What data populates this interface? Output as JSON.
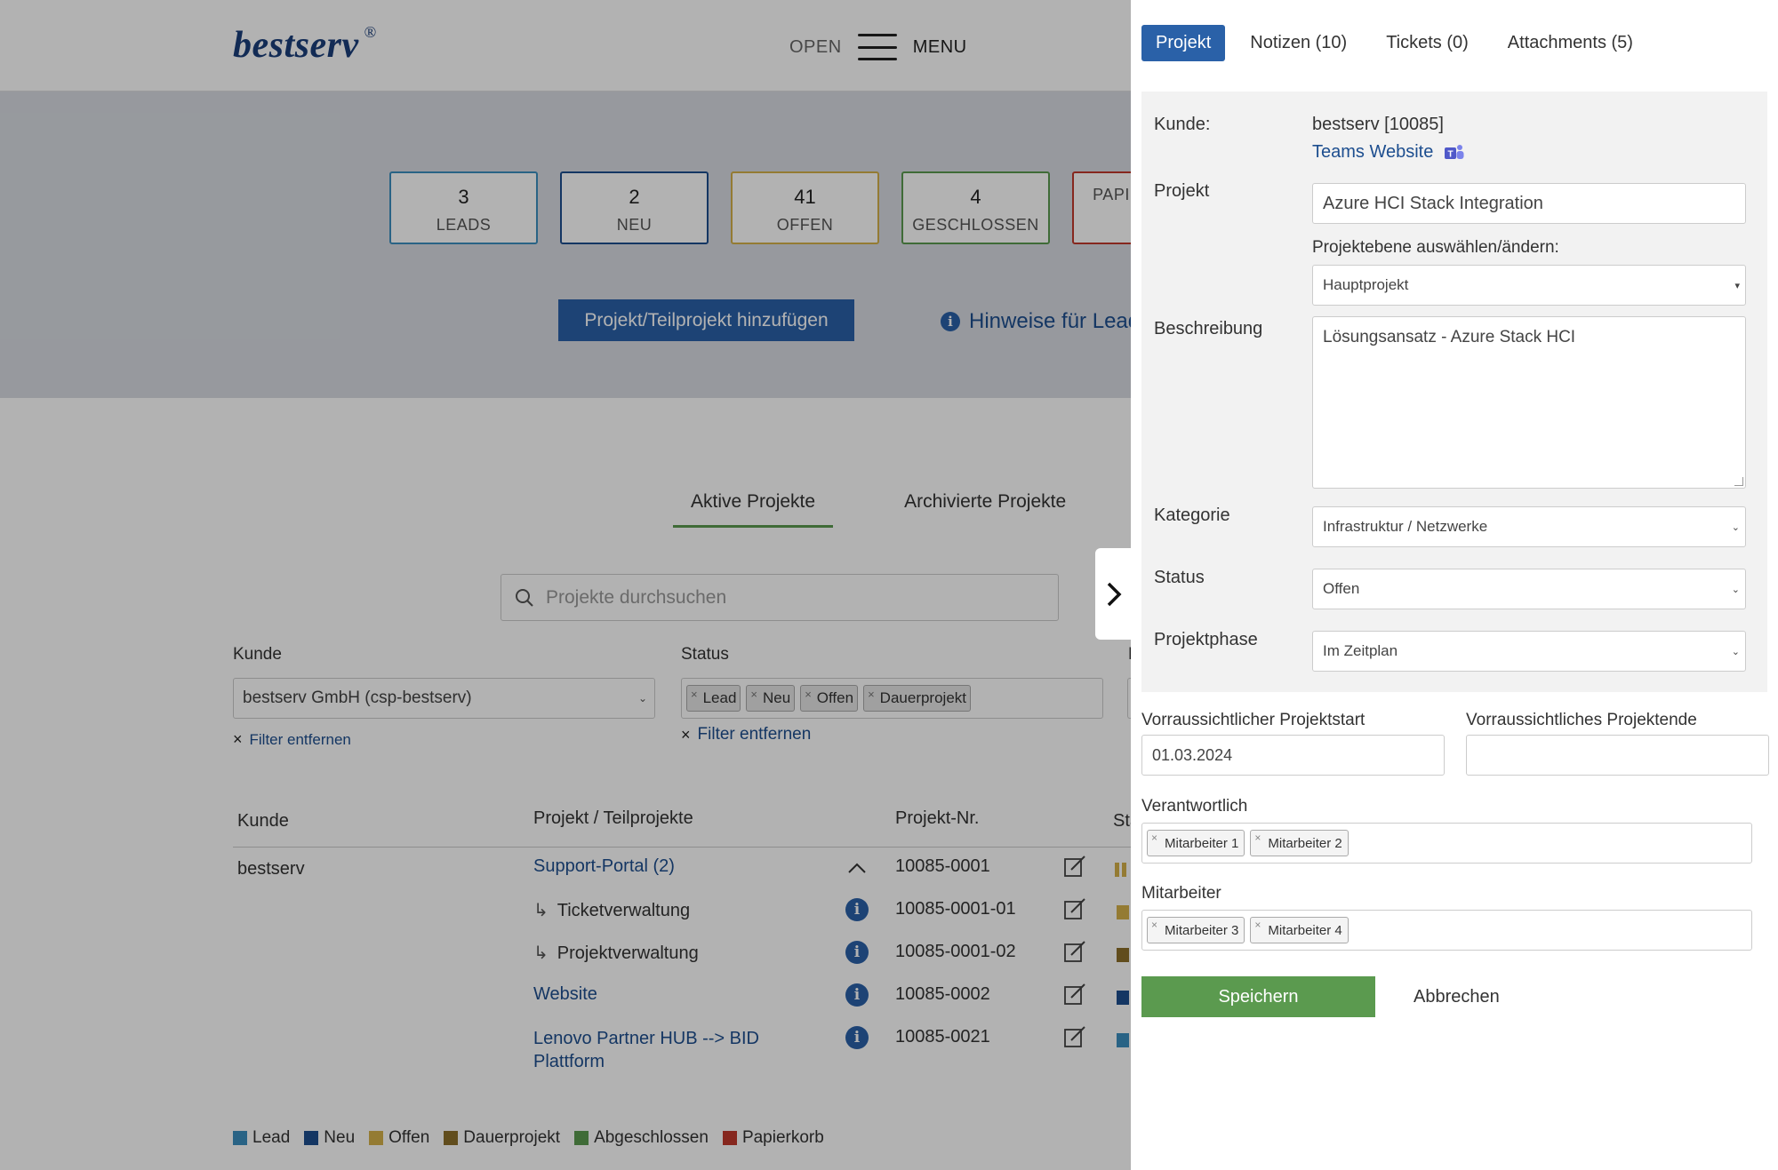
{
  "header": {
    "logo": "bestserv",
    "logo_mark": "®",
    "open_label": "OPEN",
    "menu_label": "MENU"
  },
  "stats": [
    {
      "num": "3",
      "label": "LEADS",
      "color": "#3b8fbf"
    },
    {
      "num": "2",
      "label": "NEU",
      "color": "#1d4e8f"
    },
    {
      "num": "41",
      "label": "OFFEN",
      "color": "#d4b04a"
    },
    {
      "num": "4",
      "label": "GESCHLOSSEN",
      "color": "#5b9a4f"
    },
    {
      "num": "",
      "label": "PAPIERKORB",
      "color": "#c0392b"
    }
  ],
  "hero": {
    "add_button": "Projekt/Teilprojekt hinzufügen",
    "hint": "Hinweise für Leads"
  },
  "main_tabs": {
    "active": "Aktive Projekte",
    "archived": "Archivierte Projekte"
  },
  "search": {
    "placeholder": "Projekte durchsuchen"
  },
  "filters": {
    "kunde_label": "Kunde",
    "kunde_value": "bestserv GmbH (csp-bestserv)",
    "status_label": "Status",
    "status_chips": [
      "Lead",
      "Neu",
      "Offen",
      "Dauerprojekt"
    ],
    "remove_filter": "Filter entfernen",
    "third_label": "F"
  },
  "table": {
    "headers": {
      "kunde": "Kunde",
      "projekt": "Projekt / Teilprojekte",
      "nr": "Projekt-Nr.",
      "status": "Sta"
    },
    "kunde_value": "bestserv",
    "rows": [
      {
        "name": "Support-Portal (2)",
        "nr": "10085-0001",
        "sub": false,
        "status_color": "#d4b04a"
      },
      {
        "name": "Ticketverwaltung",
        "nr": "10085-0001-01",
        "sub": true,
        "status_color": "#d4b04a"
      },
      {
        "name": "Projektverwaltung",
        "nr": "10085-0001-02",
        "sub": true,
        "status_color": "#8b6f2a"
      },
      {
        "name": "Website",
        "nr": "10085-0002",
        "sub": false,
        "status_color": "#1d4e8f"
      },
      {
        "name": "Lenovo Partner HUB --> BID",
        "name2": "Plattform",
        "nr": "10085-0021",
        "sub": false,
        "status_color": "#3b8fbf"
      }
    ]
  },
  "legend": [
    {
      "label": "Lead",
      "color": "#3b8fbf"
    },
    {
      "label": "Neu",
      "color": "#1d4e8f"
    },
    {
      "label": "Offen",
      "color": "#d4b04a"
    },
    {
      "label": "Dauerprojekt",
      "color": "#8b6f2a"
    },
    {
      "label": "Abgeschlossen",
      "color": "#5b9a4f"
    },
    {
      "label": "Papierkorb",
      "color": "#c0392b"
    }
  ],
  "panel": {
    "tabs": [
      "Projekt",
      "Notizen (10)",
      "Tickets (0)",
      "Attachments (5)"
    ],
    "kunde_label": "Kunde:",
    "kunde_value": "bestserv [10085]",
    "teams_link": "Teams Website",
    "projekt_label": "Projekt",
    "projekt_value": "Azure HCI Stack Integration",
    "ebene_label": "Projektebene auswählen/ändern:",
    "ebene_value": "Hauptprojekt",
    "beschreibung_label": "Beschreibung",
    "beschreibung_value": "Lösungsansatz - Azure Stack HCI",
    "kategorie_label": "Kategorie",
    "kategorie_value": "Infrastruktur / Netzwerke",
    "status_label": "Status",
    "status_value": "Offen",
    "phase_label": "Projektphase",
    "phase_value": "Im Zeitplan",
    "start_label": "Vorraussichtlicher Projektstart",
    "start_value": "01.03.2024",
    "ende_label": "Vorraussichtliches Projektende",
    "ende_value": "",
    "verantwortlich_label": "Verantwortlich",
    "verantwortlich": [
      "Mitarbeiter 1",
      "Mitarbeiter 2"
    ],
    "mitarbeiter_label": "Mitarbeiter",
    "mitarbeiter": [
      "Mitarbeiter 3",
      "Mitarbeiter 4"
    ],
    "save": "Speichern",
    "cancel": "Abbrechen"
  }
}
